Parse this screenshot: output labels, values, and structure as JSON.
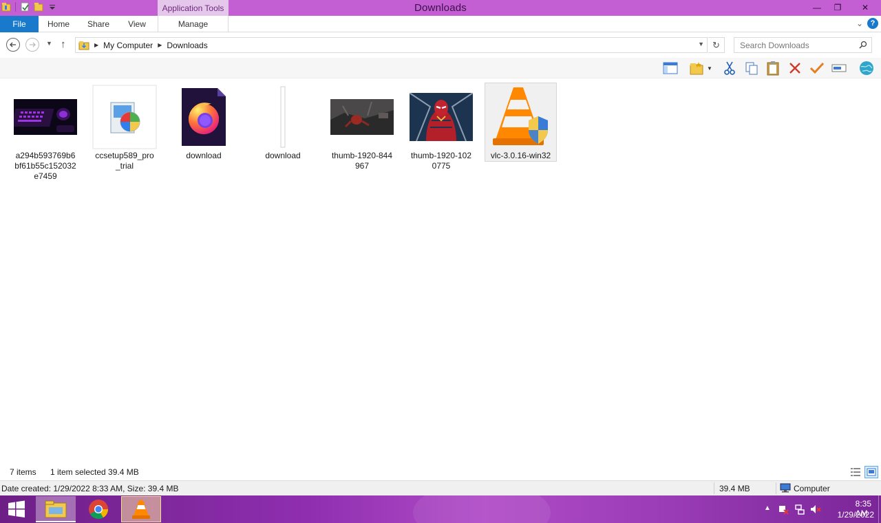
{
  "window": {
    "title": "Downloads",
    "context_tab_label": "Application Tools",
    "minimize_label": "—",
    "maximize_label": "❐",
    "close_label": "✕"
  },
  "ribbon": {
    "tabs": [
      {
        "label": "File"
      },
      {
        "label": "Home"
      },
      {
        "label": "Share"
      },
      {
        "label": "View"
      },
      {
        "label": "Manage"
      }
    ],
    "help_label": "?"
  },
  "address": {
    "crumbs": [
      "My Computer",
      "Downloads"
    ],
    "search_placeholder": "Search Downloads"
  },
  "files": [
    {
      "name": "a294b593769b6bf61b55c152032e7459",
      "kind": "image-keyboard"
    },
    {
      "name": "ccsetup589_pro_trial",
      "kind": "installer"
    },
    {
      "name": "download",
      "kind": "firefox"
    },
    {
      "name": "download",
      "kind": "blank"
    },
    {
      "name": "thumb-1920-844967",
      "kind": "image-spiderman-1"
    },
    {
      "name": "thumb-1920-1020775",
      "kind": "image-spiderman-2"
    },
    {
      "name": "vlc-3.0.16-win32",
      "kind": "vlc",
      "selected": true
    }
  ],
  "status": {
    "count": "7 items",
    "selected": "1 item selected  39.4 MB"
  },
  "details": {
    "text": "Date created: 1/29/2022 8:33 AM, Size: 39.4 MB",
    "size": "39.4 MB",
    "location": "Computer"
  },
  "clock": {
    "time": "8:35 AM",
    "date": "1/29/2022"
  },
  "colors": {
    "titlebar": "#c35fd3",
    "file_tab": "#1979ca",
    "taskbar": "#8f2fb0"
  }
}
